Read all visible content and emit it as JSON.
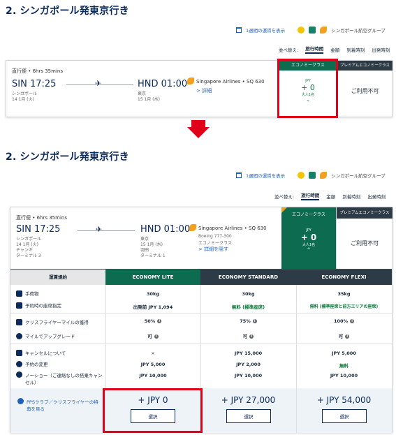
{
  "section_title": "2. シンガポール発東京行き",
  "top_links": {
    "weekly_fares": "1週間の運賃を表示",
    "airline_group": "シンガポール航空グループ"
  },
  "sort": {
    "label": "並べ替え:",
    "options": [
      "旅行時間",
      "金額",
      "到着時刻",
      "出発時刻"
    ],
    "active_index": 0
  },
  "flight": {
    "type_duration": "直行便 • 6hrs 35mins",
    "origin_code_time": "SIN 17:25",
    "origin_city": "シンガポール",
    "origin_date": "14 1月 (火)",
    "dest_code_time": "HND 01:00",
    "dest_city": "東京",
    "dest_date": "15 1月 (水)",
    "airline_flight": "Singapore Airlines • SQ 630",
    "details_link": "> 詳細",
    "details_link_hide": "> 詳細を隠す",
    "aircraft": "Boeing 777-300",
    "cabin": "エコノミークラス",
    "origin_extra": [
      "チャンギ",
      "ターミナル 3"
    ],
    "dest_extra": [
      "羽田",
      "ターミナル 1"
    ]
  },
  "cabins": {
    "economy_header": "エコノミークラス",
    "economy_currency": "JPY",
    "economy_price": "+ 0",
    "economy_pax": "大人1名",
    "premium_header": "プレミアムエコノミークラス",
    "premium_unavailable": "ご利用不可"
  },
  "fare_table": {
    "header_label": "運賃規約",
    "columns": [
      "ECONOMY LITE",
      "ECONOMY STANDARD",
      "ECONOMY FLEXI"
    ],
    "rows": [
      {
        "label": "手荷物",
        "values": [
          "30kg",
          "30kg",
          "35kg"
        ]
      },
      {
        "label": "予約時の座席指定",
        "values": [
          "出発前 JPY 1,094",
          "無料 (標準座席)",
          "無料 (標準座席と前方エリアの座席)"
        ]
      },
      {
        "label": "クリスフライヤーマイルの獲得",
        "values": [
          "50%",
          "75%",
          "100%"
        ]
      },
      {
        "label": "マイルでアップグレード",
        "values": [
          "可",
          "可",
          "可"
        ]
      },
      {
        "label": "キャンセルについて",
        "values": [
          "×",
          "JPY 15,000",
          "JPY 5,000"
        ]
      },
      {
        "label": "予約の変更",
        "values": [
          "JPY 5,000",
          "JPY 2,000",
          "無料"
        ]
      },
      {
        "label": "ノーショー（ご連絡なしの搭乗キャンセル）",
        "values": [
          "JPY 10,000",
          "JPY 10,000",
          "JPY 10,000"
        ]
      }
    ],
    "pps_link": "PPSクラブ／クリスフライヤーの特典を見る",
    "prices": [
      "+ JPY 0",
      "+ JPY 27,000",
      "+ JPY 54,000"
    ],
    "select_label": "選択"
  },
  "colors": {
    "brand_navy": "#0b2a5b",
    "economy_green": "#0d6b4f",
    "highlight_red": "#e1001a",
    "premium_dark": "#2d3b46",
    "free_green": "#0d7a3a"
  }
}
